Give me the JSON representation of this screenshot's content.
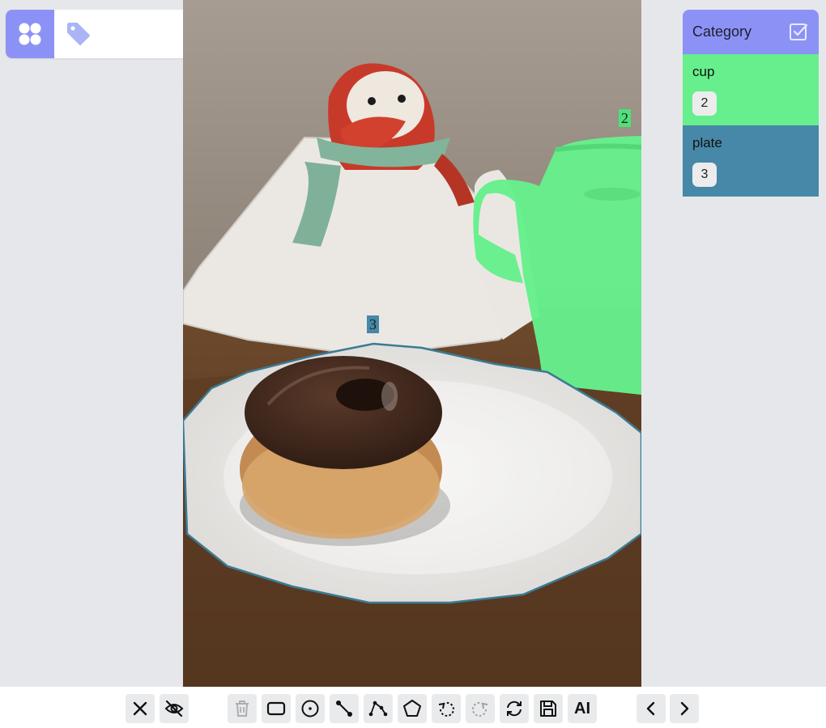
{
  "colors": {
    "accent": "#8c92f5",
    "cup": "#66ef8c",
    "plate": "#4788a8"
  },
  "top_toolbar": {
    "icons": [
      "grid-icon",
      "tag-icon",
      "gear-icon"
    ]
  },
  "annotations": [
    {
      "id": "2",
      "category": "cup"
    },
    {
      "id": "3",
      "category": "plate"
    }
  ],
  "category_panel": {
    "title": "Category",
    "items": [
      {
        "name": "cup",
        "count": "2",
        "color": "#66ef8c"
      },
      {
        "name": "plate",
        "count": "3",
        "color": "#4788a8"
      }
    ]
  },
  "bottom_toolbar": {
    "buttons": [
      {
        "icon": "close-icon"
      },
      {
        "icon": "eye-off-icon"
      },
      {
        "icon": "trash-icon",
        "disabled": true
      },
      {
        "icon": "rectangle-icon"
      },
      {
        "icon": "circle-icon"
      },
      {
        "icon": "line-icon"
      },
      {
        "icon": "polyline-icon"
      },
      {
        "icon": "polygon-icon"
      },
      {
        "icon": "undo-icon"
      },
      {
        "icon": "redo-icon",
        "disabled": true
      },
      {
        "icon": "refresh-icon"
      },
      {
        "icon": "save-icon"
      },
      {
        "icon": "ai-icon",
        "label": "AI"
      },
      {
        "icon": "chevron-left-icon"
      },
      {
        "icon": "chevron-right-icon"
      }
    ]
  }
}
